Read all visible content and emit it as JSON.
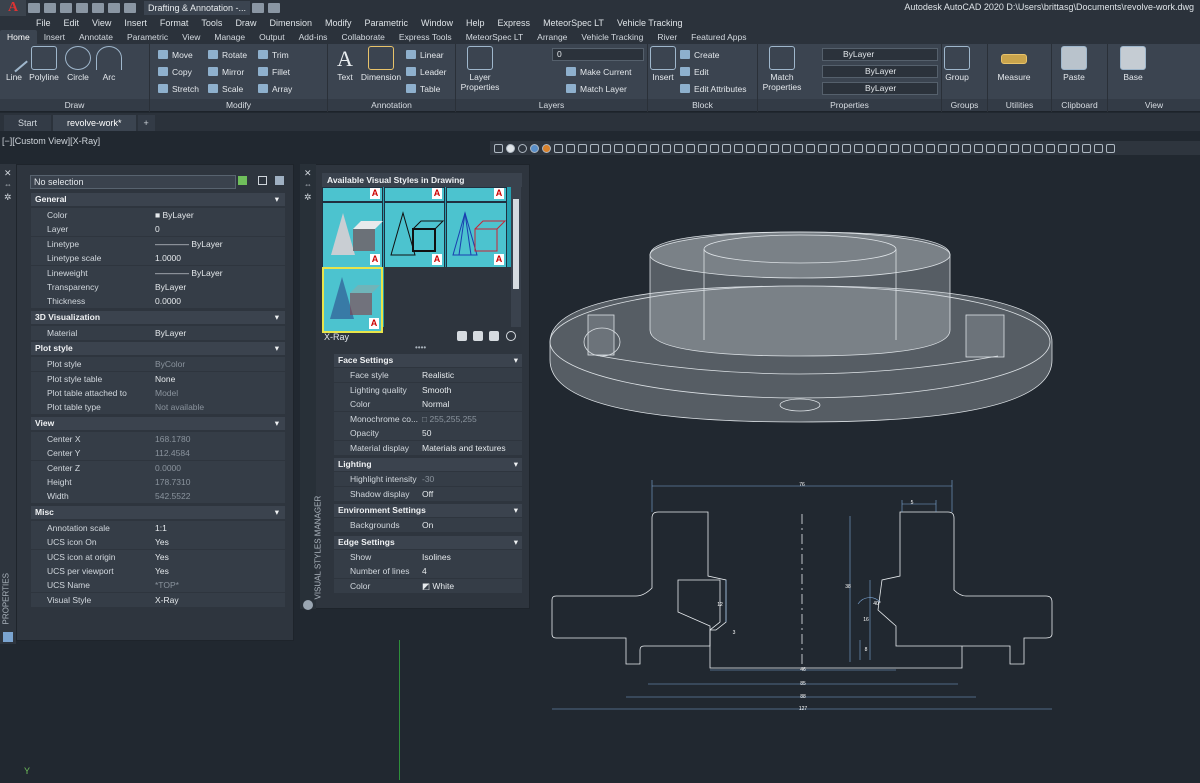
{
  "titlebar": {
    "workspace": "Drafting & Annotation -...",
    "title": "Autodesk AutoCAD 2020    D:\\Users\\brittasg\\Documents\\revolve-work.dwg",
    "app_logo": "A"
  },
  "menu": [
    "File",
    "Edit",
    "View",
    "Insert",
    "Format",
    "Tools",
    "Draw",
    "Dimension",
    "Modify",
    "Parametric",
    "Window",
    "Help",
    "Express",
    "MeteorSpec LT",
    "Vehicle Tracking"
  ],
  "ribbon_tabs": [
    "Home",
    "Insert",
    "Annotate",
    "Parametric",
    "View",
    "Manage",
    "Output",
    "Add-ins",
    "Collaborate",
    "Express Tools",
    "MeteorSpec LT",
    "Arrange",
    "Vehicle Tracking",
    "River",
    "Featured Apps"
  ],
  "ribbon": {
    "draw": {
      "title": "Draw",
      "line": "Line",
      "polyline": "Polyline",
      "circle": "Circle",
      "arc": "Arc"
    },
    "modify": {
      "title": "Modify",
      "move": "Move",
      "rotate": "Rotate",
      "trim": "Trim",
      "copy": "Copy",
      "mirror": "Mirror",
      "fillet": "Fillet",
      "stretch": "Stretch",
      "scale": "Scale",
      "array": "Array"
    },
    "annotation": {
      "title": "Annotation",
      "text": "Text",
      "dimension": "Dimension",
      "linear": "Linear",
      "leader": "Leader",
      "table": "Table"
    },
    "layers": {
      "title": "Layers",
      "layer_props_1": "Layer",
      "layer_props_2": "Properties",
      "layer_combo": "0",
      "make_current": "Make Current",
      "match_layer": "Match Layer"
    },
    "block": {
      "title": "Block",
      "insert": "Insert",
      "create": "Create",
      "edit": "Edit",
      "edit_attributes": "Edit Attributes"
    },
    "properties": {
      "title": "Properties",
      "match_1": "Match",
      "match_2": "Properties",
      "bylayer_1": "ByLayer",
      "bylayer_2": "ByLayer",
      "bylayer_3": "ByLayer"
    },
    "groups": {
      "title": "Groups",
      "group": "Group"
    },
    "utilities": {
      "title": "Utilities",
      "measure": "Measure"
    },
    "clipboard": {
      "title": "Clipboard",
      "paste": "Paste"
    },
    "view": {
      "title": "View",
      "base": "Base"
    }
  },
  "doc_tabs": [
    "Start",
    "revolve-work*"
  ],
  "viewport_label": "[−][Custom View][X-Ray]",
  "properties_panel": {
    "strip_label": "PROPERTIES",
    "selection": "No selection",
    "sections": [
      {
        "name": "General",
        "rows": [
          [
            "Color",
            "■ ByLayer"
          ],
          [
            "Layer",
            "0"
          ],
          [
            "Linetype",
            "———— ByLayer"
          ],
          [
            "Linetype scale",
            "1.0000"
          ],
          [
            "Lineweight",
            "———— ByLayer"
          ],
          [
            "Transparency",
            "ByLayer"
          ],
          [
            "Thickness",
            "0.0000"
          ]
        ]
      },
      {
        "name": "3D Visualization",
        "rows": [
          [
            "Material",
            "ByLayer"
          ]
        ]
      },
      {
        "name": "Plot style",
        "rows": [
          [
            "Plot style",
            "ByColor"
          ],
          [
            "Plot style table",
            "None"
          ],
          [
            "Plot table attached to",
            "Model"
          ],
          [
            "Plot table type",
            "Not available"
          ]
        ]
      },
      {
        "name": "View",
        "rows": [
          [
            "Center X",
            "168.1780"
          ],
          [
            "Center Y",
            "112.4584"
          ],
          [
            "Center Z",
            "0.0000"
          ],
          [
            "Height",
            "178.7310"
          ],
          [
            "Width",
            "542.5522"
          ]
        ]
      },
      {
        "name": "Misc",
        "rows": [
          [
            "Annotation scale",
            "1:1"
          ],
          [
            "UCS icon On",
            "Yes"
          ],
          [
            "UCS icon at origin",
            "Yes"
          ],
          [
            "UCS per viewport",
            "Yes"
          ],
          [
            "UCS Name",
            "*TOP*"
          ],
          [
            "Visual Style",
            "X-Ray"
          ]
        ]
      }
    ]
  },
  "visual_styles": {
    "strip_label": "VISUAL STYLES MANAGER",
    "header": "Available Visual Styles in Drawing",
    "current": "X-Ray",
    "swatch_letter": "A",
    "sections": [
      {
        "name": "Face Settings",
        "rows": [
          [
            "Face style",
            "Realistic"
          ],
          [
            "Lighting quality",
            "Smooth"
          ],
          [
            "Color",
            "Normal"
          ],
          [
            "Monochrome co...",
            "□ 255,255,255"
          ],
          [
            "Opacity",
            "50"
          ],
          [
            "Material display",
            "Materials and textures"
          ]
        ]
      },
      {
        "name": "Lighting",
        "rows": [
          [
            "Highlight intensity",
            "-30"
          ],
          [
            "Shadow display",
            "Off"
          ]
        ]
      },
      {
        "name": "Environment Settings",
        "rows": [
          [
            "Backgrounds",
            "On"
          ]
        ]
      },
      {
        "name": "Edge Settings",
        "rows": [
          [
            "Show",
            "Isolines"
          ],
          [
            "Number of lines",
            "4"
          ],
          [
            "Color",
            "◩ White"
          ]
        ]
      }
    ]
  },
  "drawing": {
    "dims": [
      "76",
      "5",
      "12",
      "3",
      "38",
      "40°",
      "16",
      "8",
      "46",
      "85",
      "88",
      "127"
    ]
  }
}
